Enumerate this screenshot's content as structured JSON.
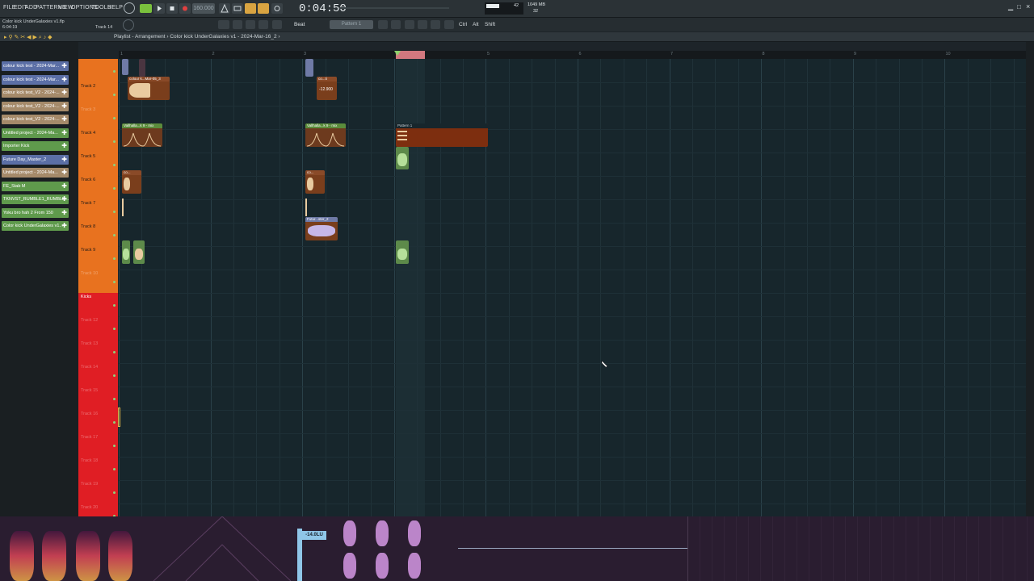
{
  "menu": {
    "file": "FILE",
    "edit": "EDIT",
    "add": "ADD",
    "patterns": "PATTERNS",
    "view": "VIEW",
    "options": "OPTIONS",
    "tools": "TOOLS",
    "help": "HELP"
  },
  "transport": {
    "bpm": "160.000",
    "time": "0:04:50",
    "cpu": "42",
    "ram": "1049 MB",
    "poly": "32"
  },
  "project": {
    "filename": "Color kick UnderGalaxies v1.flp",
    "position": "6:04:19",
    "track": "Track 14"
  },
  "toolbar2": {
    "snap": "Beat",
    "pattern": "Pattern 1",
    "ctrl": "Ctrl",
    "alt": "Alt",
    "shift": "Shift"
  },
  "playlist": {
    "title": "Playlist - Arrangement › Color kick UnderGalaxies v1 - 2024-Mar-16_2 ›"
  },
  "ruler": [
    "1",
    "2",
    "3",
    "4",
    "5",
    "6",
    "7",
    "8",
    "9",
    "10"
  ],
  "browser_clips": [
    {
      "label": "colour kick test - 2024-Mar...",
      "color": "#5b6fa6"
    },
    {
      "label": "colour kick test - 2024-Mar...",
      "color": "#5b6fa6"
    },
    {
      "label": "colour kick test_V2 - 2024-...",
      "color": "#a58a6a"
    },
    {
      "label": "colour kick test_V2 - 2024-...",
      "color": "#a58a6a"
    },
    {
      "label": "colour kick test_V2 - 2024-...",
      "color": "#a58a6a"
    },
    {
      "label": "Untitled project - 2024-Ma...",
      "color": "#5f9a4c"
    },
    {
      "label": "Importer Kick",
      "color": "#5f9a4c"
    },
    {
      "label": "Future Day_Master_2",
      "color": "#5b6fa6"
    },
    {
      "label": "Untitled project - 2024-Ma...",
      "color": "#a58a6a"
    },
    {
      "label": "FE_Stab M",
      "color": "#5f9a4c"
    },
    {
      "label": "TKNVST_RUMBLE1_RUMBLE...",
      "color": "#5f9a4c"
    },
    {
      "label": "Yoku bro hah 2 From 150",
      "color": "#5f9a4c"
    },
    {
      "label": "Color kick UnderGalaxies v1...",
      "color": "#5f9a4c"
    }
  ],
  "tracks": [
    "",
    "Track 2",
    "Track 3",
    "Track 4",
    "Track 5",
    "Track 6",
    "Track 7",
    "Track 8",
    "Track 9",
    "Track 10",
    "Kicks",
    "Track 12",
    "Track 13",
    "Track 14",
    "Track 15",
    "Track 16",
    "Track 17",
    "Track 18",
    "Track 19",
    "Track 20"
  ],
  "clips": {
    "c1": "colour k...Mar-05_3",
    "c2": "co...ti",
    "c2val": "-12.900",
    "c3": "Vallhalla...k 9 - mix",
    "c4": "Vallhalla...k 9 - mix",
    "c5": "Pattern 1",
    "c6": "co...",
    "c7": "co...",
    "c8": "Futur...ster_2"
  },
  "meter": {
    "lufs": "-14.0LU"
  },
  "colors": {
    "track_orange": "#e8721f",
    "kicks_red": "#e01e24",
    "grid_bg": "#17262c",
    "playhead": "#d2787f"
  }
}
